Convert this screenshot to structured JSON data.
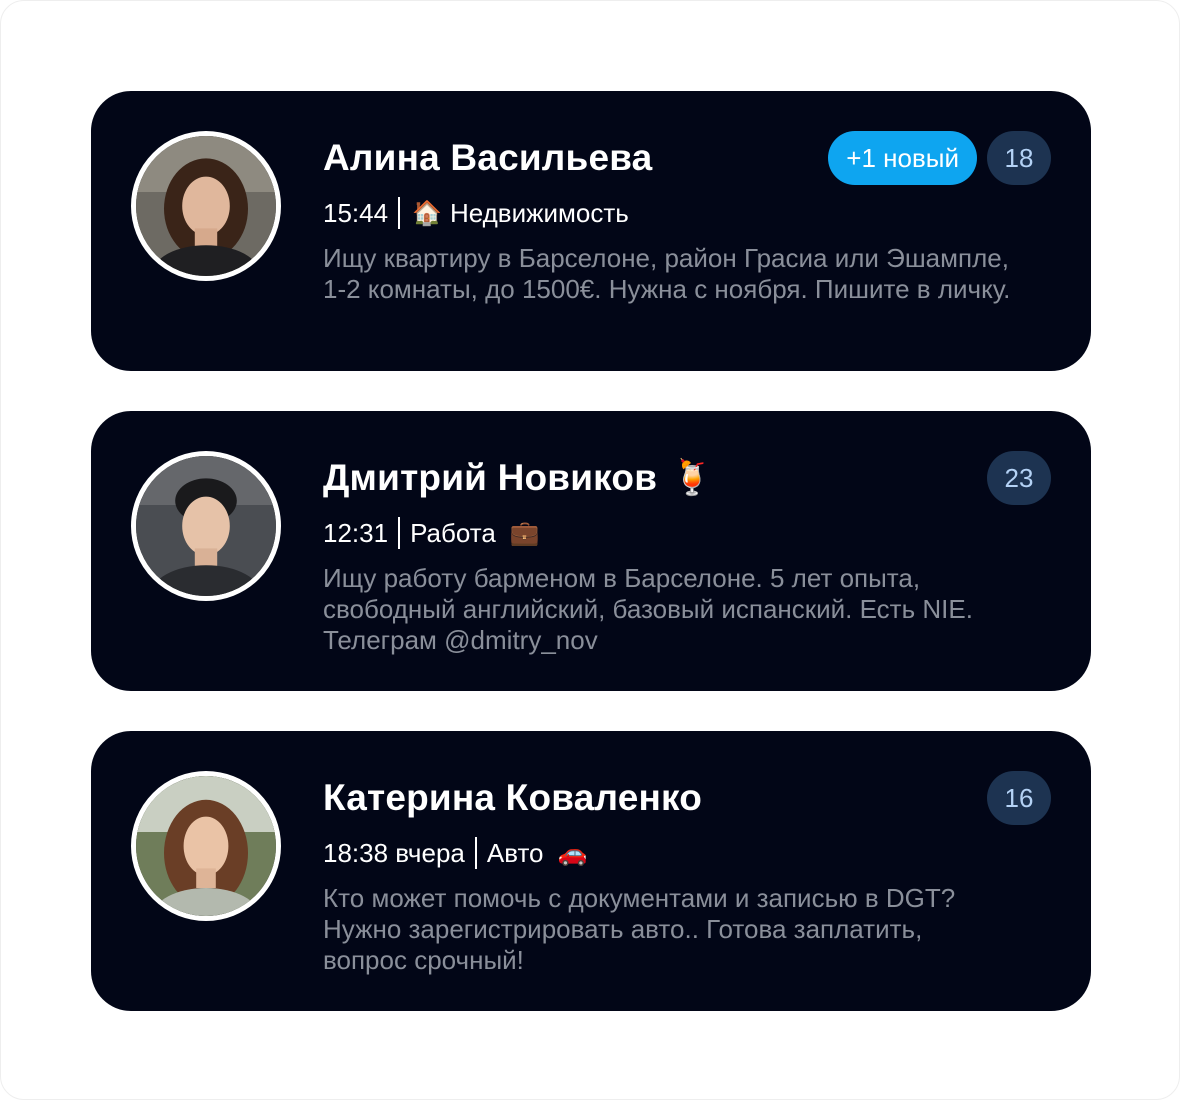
{
  "posts": [
    {
      "author": "Алина Васильева",
      "author_emoji": "",
      "time": "15:44",
      "category_emoji": "🏠",
      "category": "Недвижимость",
      "message": "Ищу квартиру в Барселоне, район Грасиа или Эшампле, 1-2 комнаты, до 1500€. Нужна с ноября. Пишите в личку.",
      "new_badge": "+1 новый",
      "count": "18"
    },
    {
      "author": "Дмитрий Новиков",
      "author_emoji": "🍹",
      "time": "12:31",
      "category": "Работа",
      "category_emoji": "💼",
      "message": "Ищу работу барменом в Барселоне. 5 лет опыта, свободный английский, базовый испанский. Есть NIE. Телеграм @dmitry_nov",
      "count": "23"
    },
    {
      "author": "Катерина Коваленко",
      "author_emoji": "",
      "time": "18:38 вчера",
      "category": "Авто",
      "category_emoji": "🚗",
      "message": "Кто может помочь с документами и записью в DGT? Нужно зарегистрировать авто.. Готова заплатить, вопрос срочный!",
      "count": "16"
    }
  ],
  "colors": {
    "card_bg": "#020617",
    "badge_new": "#0ea5f0",
    "count_bg": "#1d3351",
    "message_text": "#8a8f9a"
  }
}
